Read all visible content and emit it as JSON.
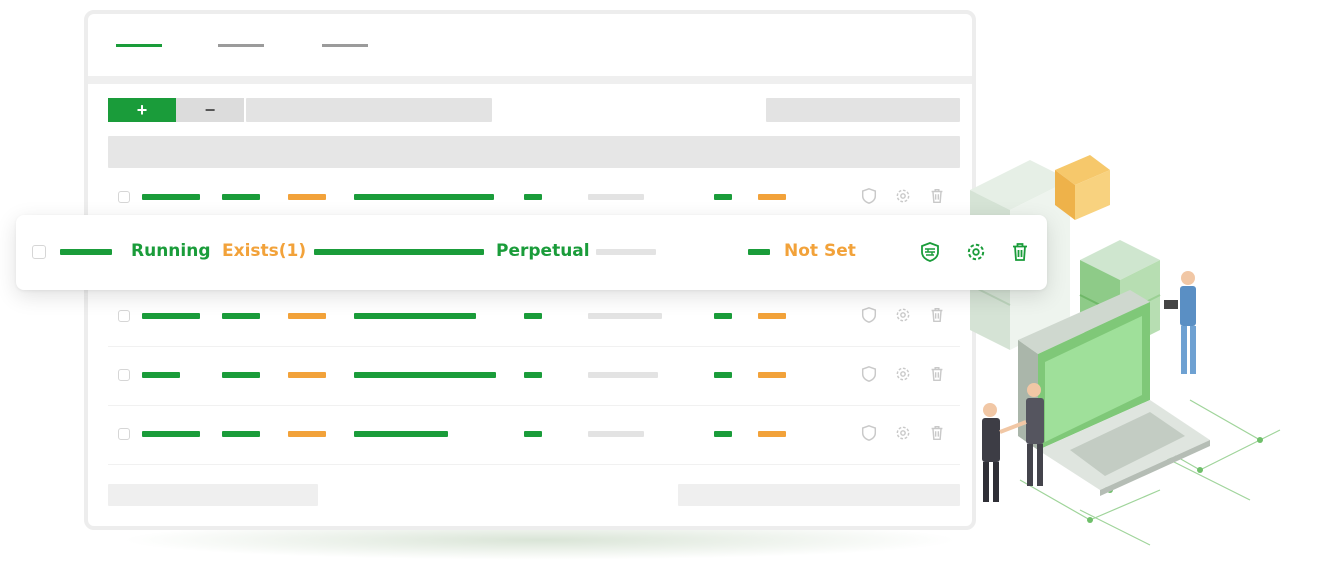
{
  "colors": {
    "green": "#1a9c3a",
    "orange": "#f2a23a",
    "gray": "#e3e3e3"
  },
  "toolbar": {
    "add_label": "+",
    "remove_label": "−"
  },
  "highlighted_row": {
    "status": "Running",
    "exists": "Exists(1)",
    "license": "Perpetual",
    "setting": "Not Set",
    "icons": [
      "shield-icon",
      "gear-icon",
      "trash-icon"
    ]
  }
}
